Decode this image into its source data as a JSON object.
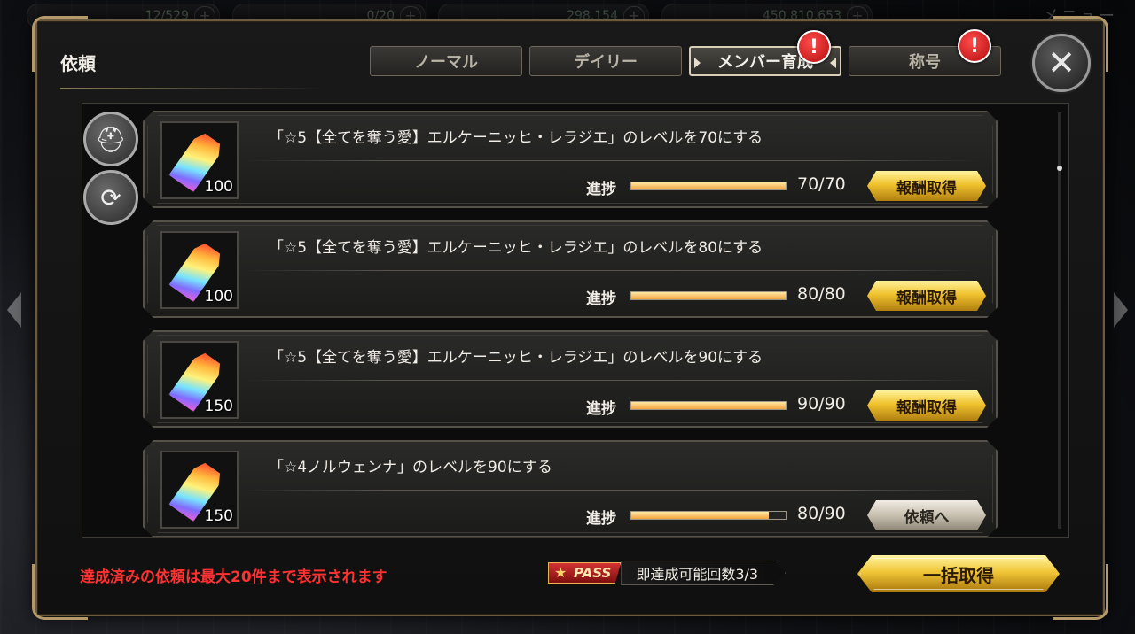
{
  "hud": {
    "ap": "12/529",
    "bp": "0/20",
    "gems": "298,154",
    "gold": "450,810,653",
    "menu_label": "メニュー"
  },
  "dialog": {
    "title": "依頼",
    "close_label": "✕"
  },
  "tabs": [
    {
      "label": "ノーマル",
      "active": false,
      "alert": false
    },
    {
      "label": "デイリー",
      "active": false,
      "alert": false
    },
    {
      "label": "メンバー育成",
      "active": true,
      "alert": true
    },
    {
      "label": "称号",
      "active": false,
      "alert": true
    }
  ],
  "alert_symbol": "!",
  "side_buttons": {
    "filter_icon": "helmet-icon",
    "refresh_icon": "refresh-icon"
  },
  "quests": [
    {
      "desc": "「☆5【全てを奪う愛】エルケーニッヒ・レラジエ」のレベルを70にする",
      "reward_qty": "100",
      "progress_label": "進捗",
      "progress_value": "70/70",
      "progress_fraction": 1.0,
      "button_label": "報酬取得",
      "button_style": "gold"
    },
    {
      "desc": "「☆5【全てを奪う愛】エルケーニッヒ・レラジエ」のレベルを80にする",
      "reward_qty": "100",
      "progress_label": "進捗",
      "progress_value": "80/80",
      "progress_fraction": 1.0,
      "button_label": "報酬取得",
      "button_style": "gold"
    },
    {
      "desc": "「☆5【全てを奪う愛】エルケーニッヒ・レラジエ」のレベルを90にする",
      "reward_qty": "150",
      "progress_label": "進捗",
      "progress_value": "90/90",
      "progress_fraction": 1.0,
      "button_label": "報酬取得",
      "button_style": "gold"
    },
    {
      "desc": "「☆4ノルウェンナ」のレベルを90にする",
      "reward_qty": "150",
      "progress_label": "進捗",
      "progress_value": "80/90",
      "progress_fraction": 0.889,
      "button_label": "依頼へ",
      "button_style": "silver"
    }
  ],
  "footer": {
    "note": "達成済みの依頼は最大20件まで表示されます",
    "pass_label": "PASS",
    "instant_text": "即達成可能回数3/3",
    "bulk_button": "一括取得"
  },
  "colors": {
    "gold_button": "#f0c22e",
    "note_red": "#ff3131",
    "progress_fill": "#f2a640"
  }
}
